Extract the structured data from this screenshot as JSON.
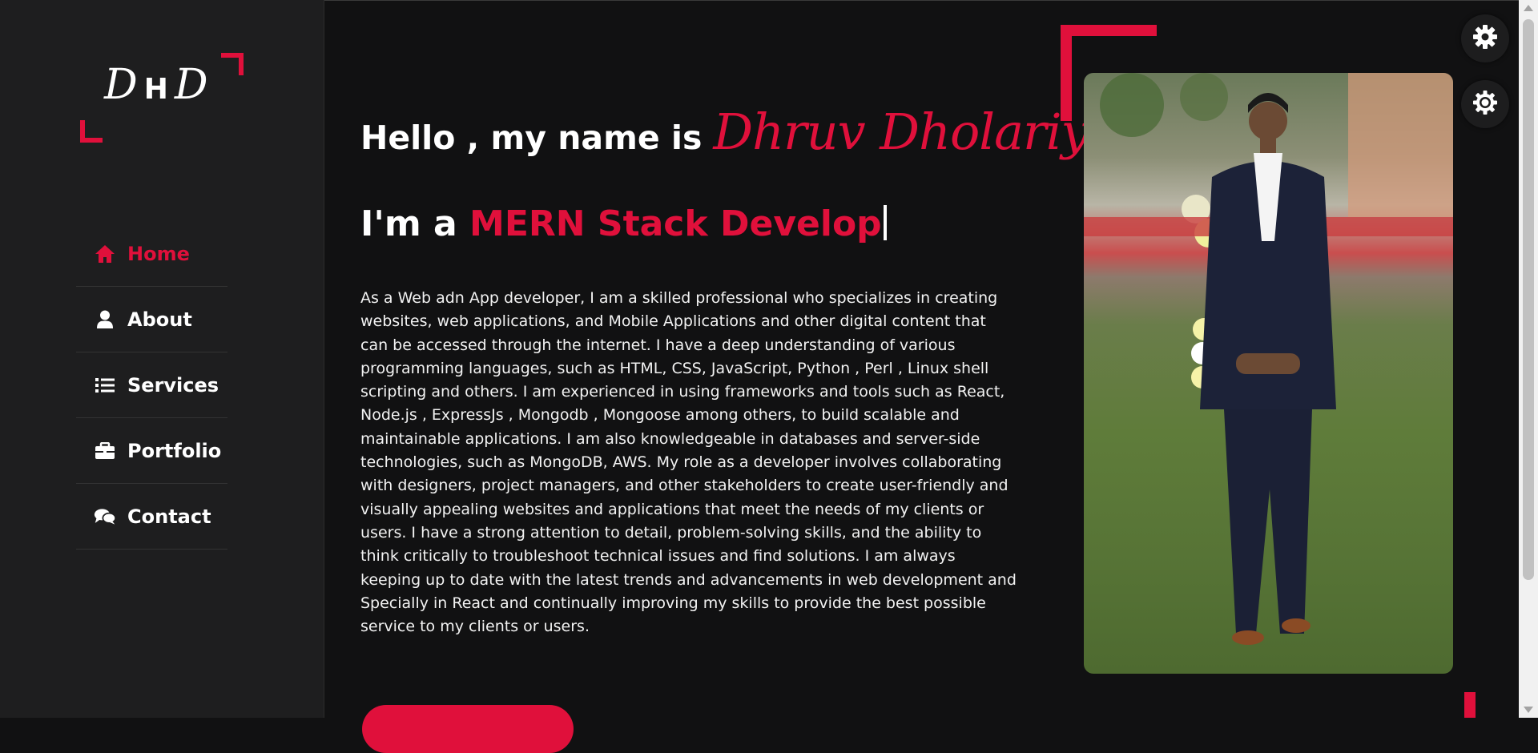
{
  "logo": {
    "left": "D",
    "middle": "H",
    "right": "D"
  },
  "nav": {
    "items": [
      {
        "label": "Home",
        "icon": "home-icon",
        "active": true
      },
      {
        "label": "About",
        "icon": "user-icon",
        "active": false
      },
      {
        "label": "Services",
        "icon": "list-icon",
        "active": false
      },
      {
        "label": "Portfolio",
        "icon": "briefcase-icon",
        "active": false
      },
      {
        "label": "Contact",
        "icon": "chat-icon",
        "active": false
      }
    ]
  },
  "hero": {
    "greeting": "Hello , my name is",
    "name": "Dhruv Dholariya",
    "role_prefix": "I'm a",
    "role_typed": "MERN Stack Develop",
    "bio": "As a Web adn App developer, I am a skilled professional who specializes in creating websites, web applications, and Mobile Applications and other digital content that can be accessed through the internet. I have a deep understanding of various programming languages, such as HTML, CSS, JavaScript, Python , Perl , Linux shell scripting and others. I am experienced in using frameworks and tools such as React, Node.js , ExpressJs , Mongodb , Mongoose among others, to build scalable and maintainable applications. I am also knowledgeable in databases and server-side technologies, such as MongoDB, AWS. My role as a developer involves collaborating with designers, project managers, and other stakeholders to create user-friendly and visually appealing websites and applications that meet the needs of my clients or users. I have a strong attention to detail, problem-solving skills, and the ability to think critically to troubleshoot technical issues and find solutions. I am always keeping up to date with the latest trends and advancements in web development and Specially in React and continually improving my skills to provide the best possible service to my clients or users."
  },
  "floating": {
    "settings_icon": "gear-icon",
    "theme_icon": "sun-gear-icon"
  },
  "colors": {
    "accent": "#e0103b",
    "background": "#111112",
    "sidebar": "#1e1e1f"
  }
}
